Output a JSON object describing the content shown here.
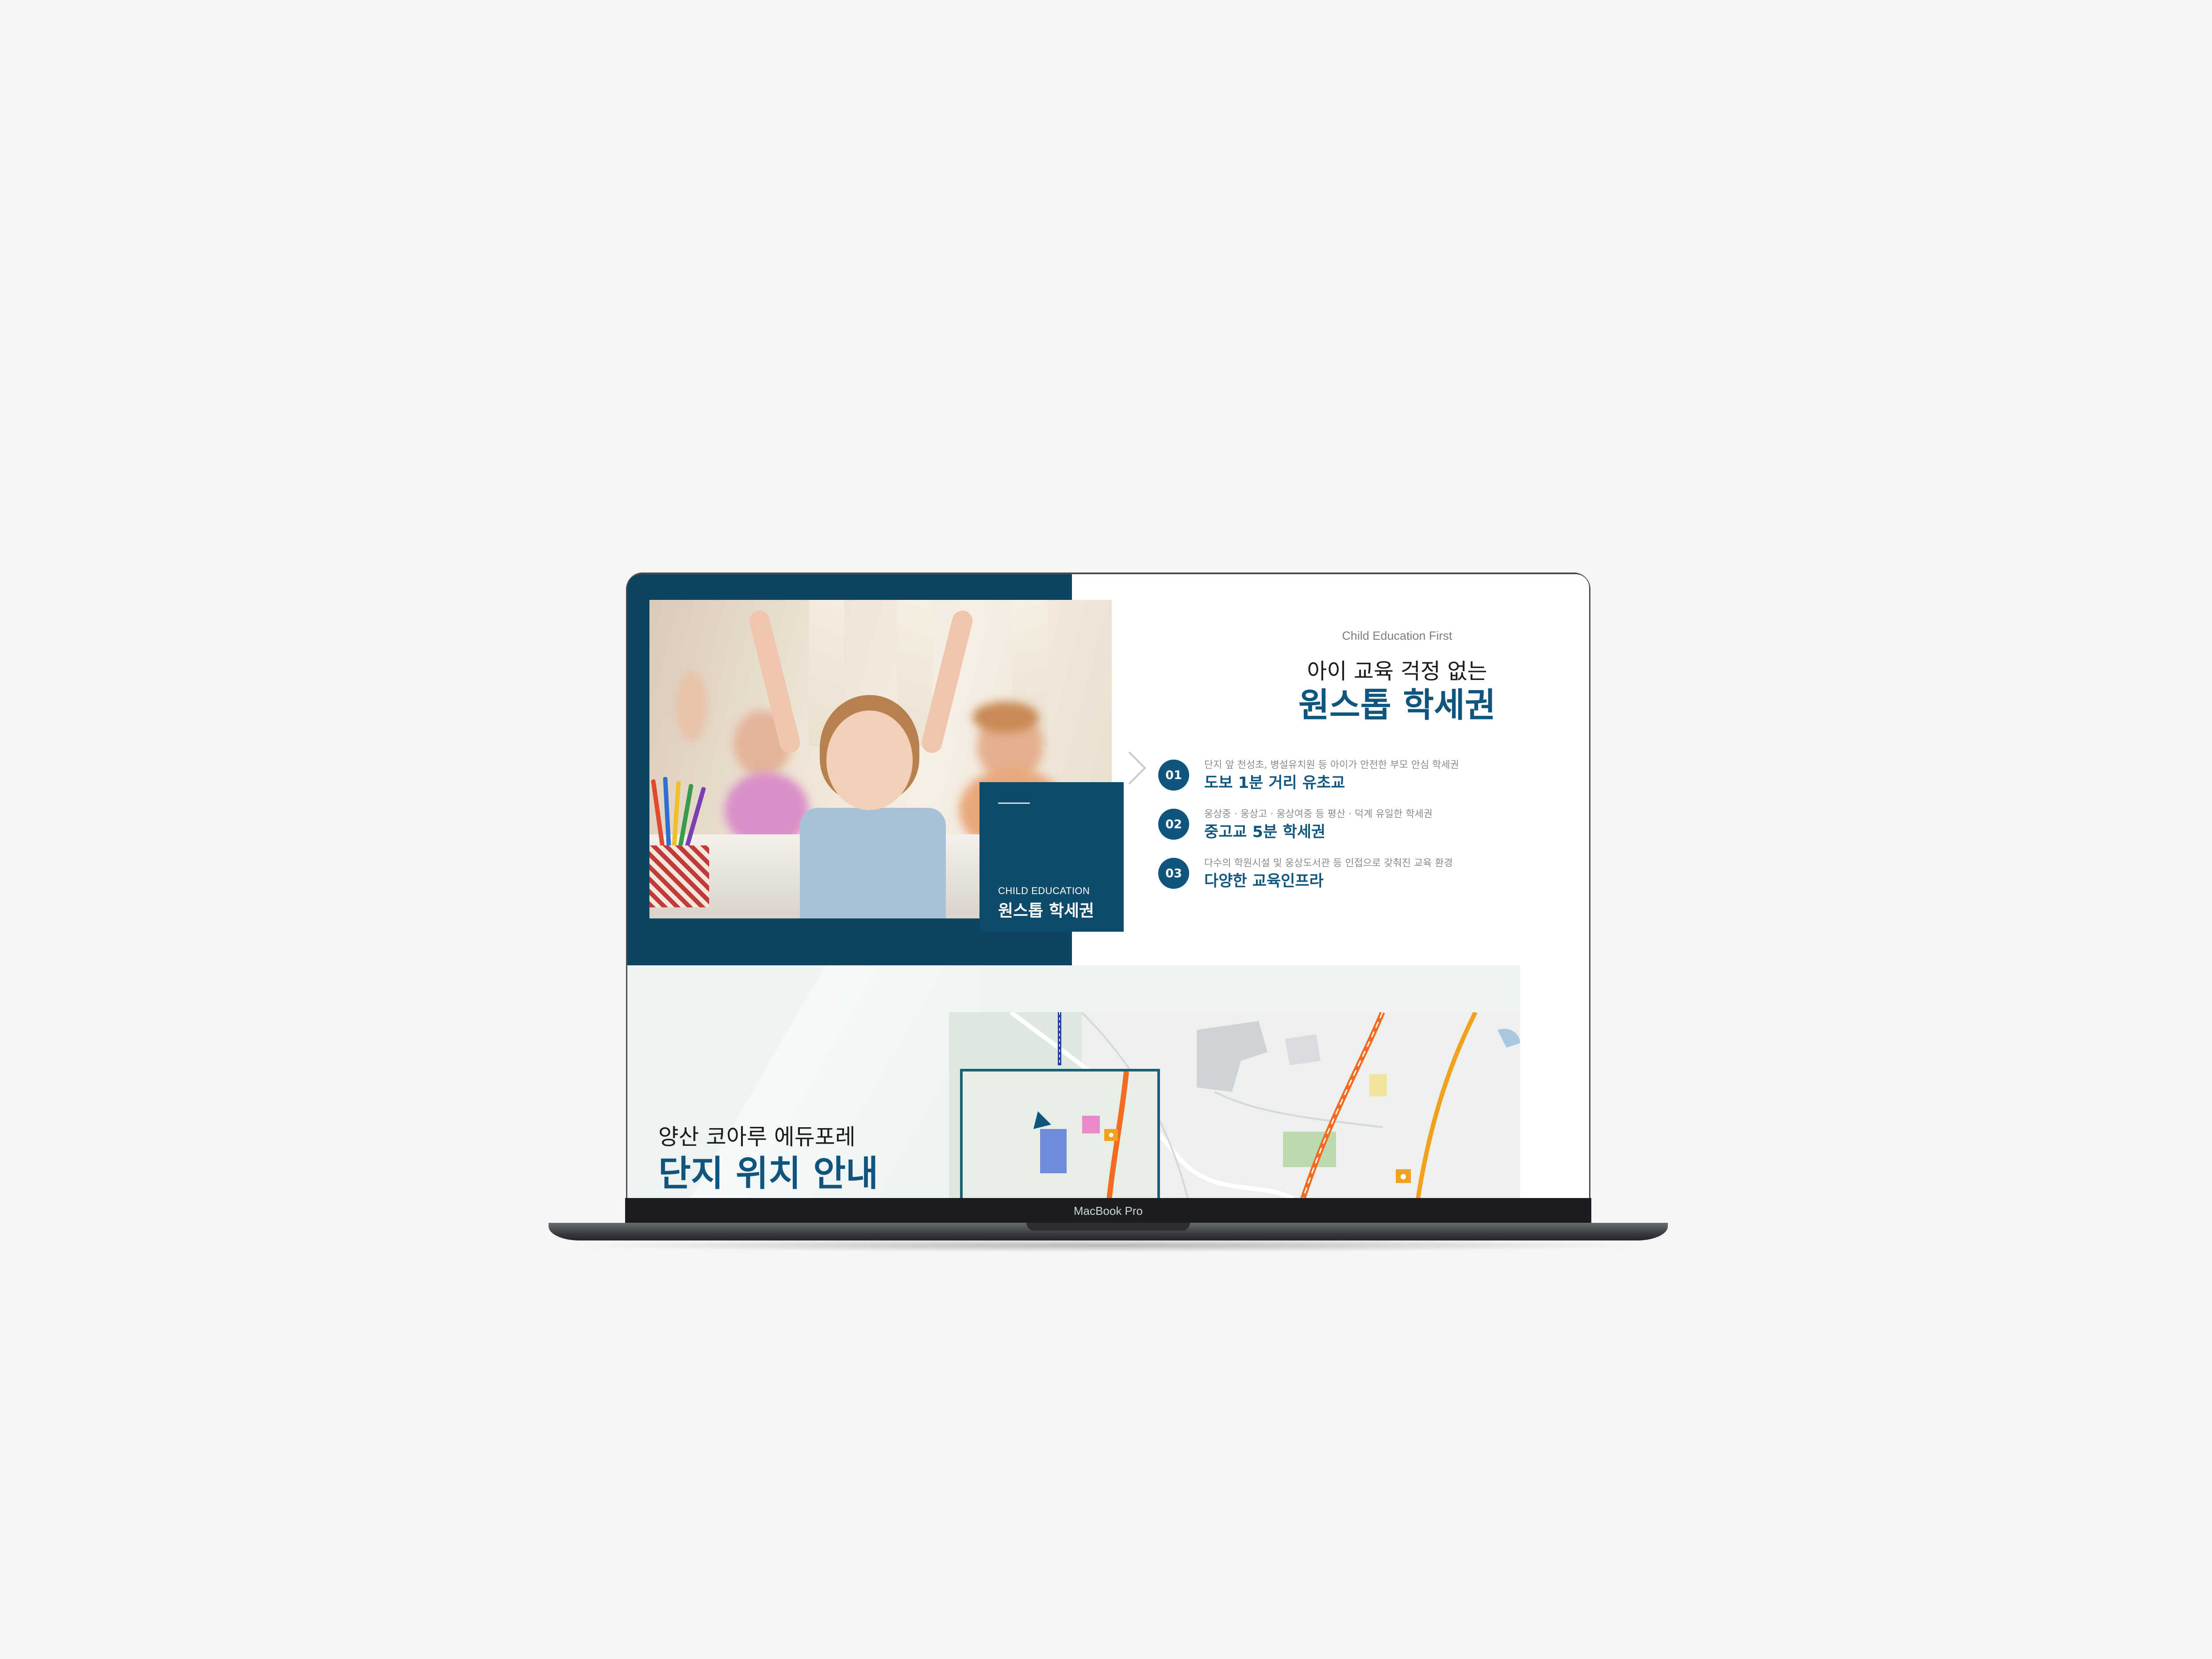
{
  "device": {
    "label": "MacBook Pro"
  },
  "hero": {
    "eyebrow": "Child Education First",
    "subtitle": "아이 교육 걱정 없는",
    "title": "원스톱 학세권",
    "caption_en": "CHILD EDUCATION",
    "caption_ko": "원스톱 학세권"
  },
  "features": [
    {
      "number": "01",
      "desc": "단지 앞 천성초, 병설유치원 등 아이가 안전한 부모 안심 학세권",
      "title": "도보 1분 거리 유초교"
    },
    {
      "number": "02",
      "desc": "웅상중 · 웅상고 · 웅상여중 등 평산 · 덕계 유일한 학세권",
      "title": "중고교 5분 학세권"
    },
    {
      "number": "03",
      "desc": "다수의 학원시설 및 웅상도서관 등 인접으로 갖춰진 교육 환경",
      "title": "다양한 교육인프라"
    }
  ],
  "location": {
    "subtitle": "양산 코아루 에듀포레",
    "title": "단지 위치 안내"
  },
  "colors": {
    "primary": "#0f557e",
    "hero_bg": "#0e4461",
    "background": "#f5f5f5"
  },
  "icons": [
    "chevron-right-icon"
  ]
}
